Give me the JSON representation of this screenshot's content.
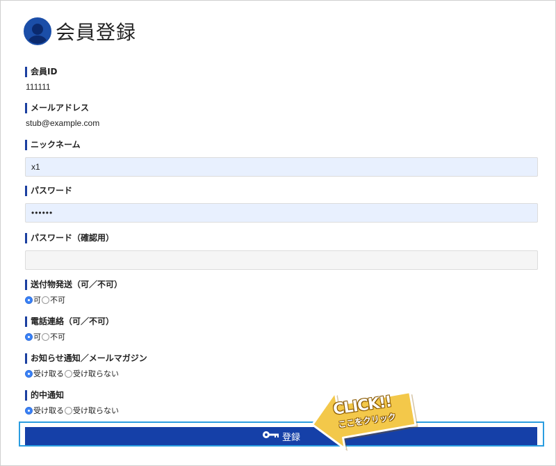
{
  "page": {
    "title": "会員登録"
  },
  "fields": {
    "member_id": {
      "label": "会員ID",
      "value": "111111"
    },
    "email": {
      "label": "メールアドレス",
      "value": "stub@example.com"
    },
    "nickname": {
      "label": "ニックネーム",
      "value": "x1"
    },
    "password": {
      "label": "パスワード",
      "value": "••••••"
    },
    "password_confirm": {
      "label": "パスワード（確認用）",
      "value": ""
    }
  },
  "radio_groups": {
    "shipping": {
      "label": "送付物発送（可／不可）",
      "options": [
        "可",
        "不可"
      ],
      "selected": "可"
    },
    "phone": {
      "label": "電話連絡（可／不可）",
      "options": [
        "可",
        "不可"
      ],
      "selected": "可"
    },
    "newsletter": {
      "label": "お知らせ通知／メールマガジン",
      "options": [
        "受け取る",
        "受け取らない"
      ],
      "selected": "受け取る"
    },
    "winning": {
      "label": "的中通知",
      "options": [
        "受け取る",
        "受け取らない"
      ],
      "selected": "受け取る"
    }
  },
  "submit": {
    "label": "登録"
  },
  "callout": {
    "line1": "CLICK!!",
    "line2": "ここをクリック"
  },
  "colors": {
    "accent": "#1540a8",
    "outline": "#2a9de0",
    "callout": "#f3c84a"
  },
  "icons": {
    "avatar": "user-icon",
    "submit": "key-icon"
  }
}
